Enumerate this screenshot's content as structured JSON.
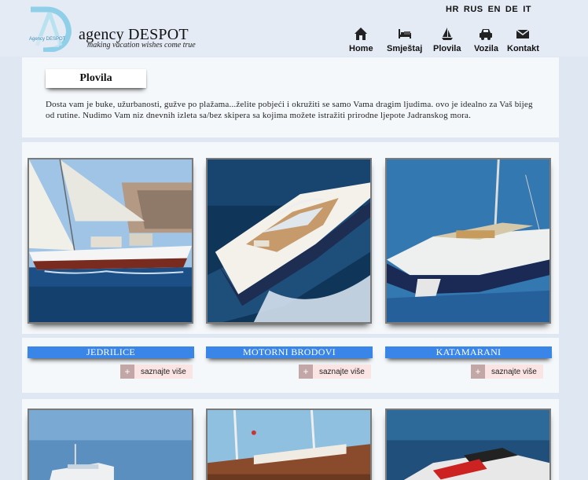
{
  "brand": {
    "name": "agency DESPOT",
    "tagline": "making vacation wishes come true",
    "logo_letters": "DA",
    "logo_sub": "Agency DESPOT",
    "logo_color": "#8fd0e8"
  },
  "languages": [
    "HR",
    "RUS",
    "EN",
    "DE",
    "IT"
  ],
  "nav": [
    {
      "label": "Home",
      "icon": "home-icon"
    },
    {
      "label": "Smještaj",
      "icon": "bed-icon"
    },
    {
      "label": "Plovila",
      "icon": "sailboat-icon"
    },
    {
      "label": "Vozila",
      "icon": "car-icon"
    },
    {
      "label": "Kontakt",
      "icon": "envelope-icon"
    }
  ],
  "intro": {
    "title": "Plovila",
    "text": "Dosta vam je buke, užurbanosti, gužve po plažama...želite pobjeći i okružiti se samo Vama dragim ljudima. ovo je idealno za Vaš bijeg od rutine. Nudimo Vam niz dnevnih izleta sa/bez skipera sa kojima možete istražiti prirodne ljepote Jadranskog mora."
  },
  "categories": [
    {
      "label": "JEDRILICE",
      "more": "saznajte više"
    },
    {
      "label": "MOTORNI BRODOVI",
      "more": "saznajte više"
    },
    {
      "label": "KATAMARANI",
      "more": "saznajte više"
    }
  ],
  "colors": {
    "accent": "#3a86e8",
    "background": "#dfe7f2",
    "panel": "#f5f8fb",
    "more_bg": "#fbe4e4"
  }
}
